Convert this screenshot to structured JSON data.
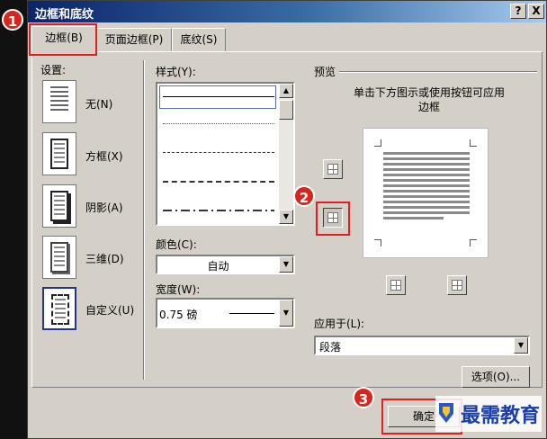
{
  "dialog": {
    "title": "边框和底纹",
    "help_label": "?",
    "close_label": "X"
  },
  "tabs": [
    {
      "label": "边框(B)"
    },
    {
      "label": "页面边框(P)"
    },
    {
      "label": "底纹(S)"
    }
  ],
  "settings": {
    "header": "设置:",
    "items": [
      {
        "label": "无(N)"
      },
      {
        "label": "方框(X)"
      },
      {
        "label": "阴影(A)"
      },
      {
        "label": "三维(D)"
      },
      {
        "label": "自定义(U)"
      }
    ]
  },
  "style": {
    "header": "样式(Y):",
    "options": [
      "solid",
      "dotted-fine",
      "dashed-short",
      "dashed-long",
      "dash-dot"
    ]
  },
  "color": {
    "label": "颜色(C):",
    "value": "自动"
  },
  "width": {
    "label": "宽度(W):",
    "value": "0.75 磅"
  },
  "preview": {
    "header": "预览",
    "instruction": "单击下方图示或使用按钮可应用边框"
  },
  "apply_to": {
    "label": "应用于(L):",
    "value": "段落"
  },
  "buttons": {
    "options_label": "选项(O)...",
    "ok_label": "确定"
  },
  "badges": [
    "1",
    "2",
    "3"
  ],
  "watermark": {
    "text": "最需教育"
  },
  "colors": {
    "title_start": "#0a246a",
    "title_end": "#a6caf0",
    "dialog_bg": "#d4d0c8",
    "highlight_red": "#e02020",
    "badge_red": "#d7261e",
    "watermark_blue": "#1a3da8"
  }
}
